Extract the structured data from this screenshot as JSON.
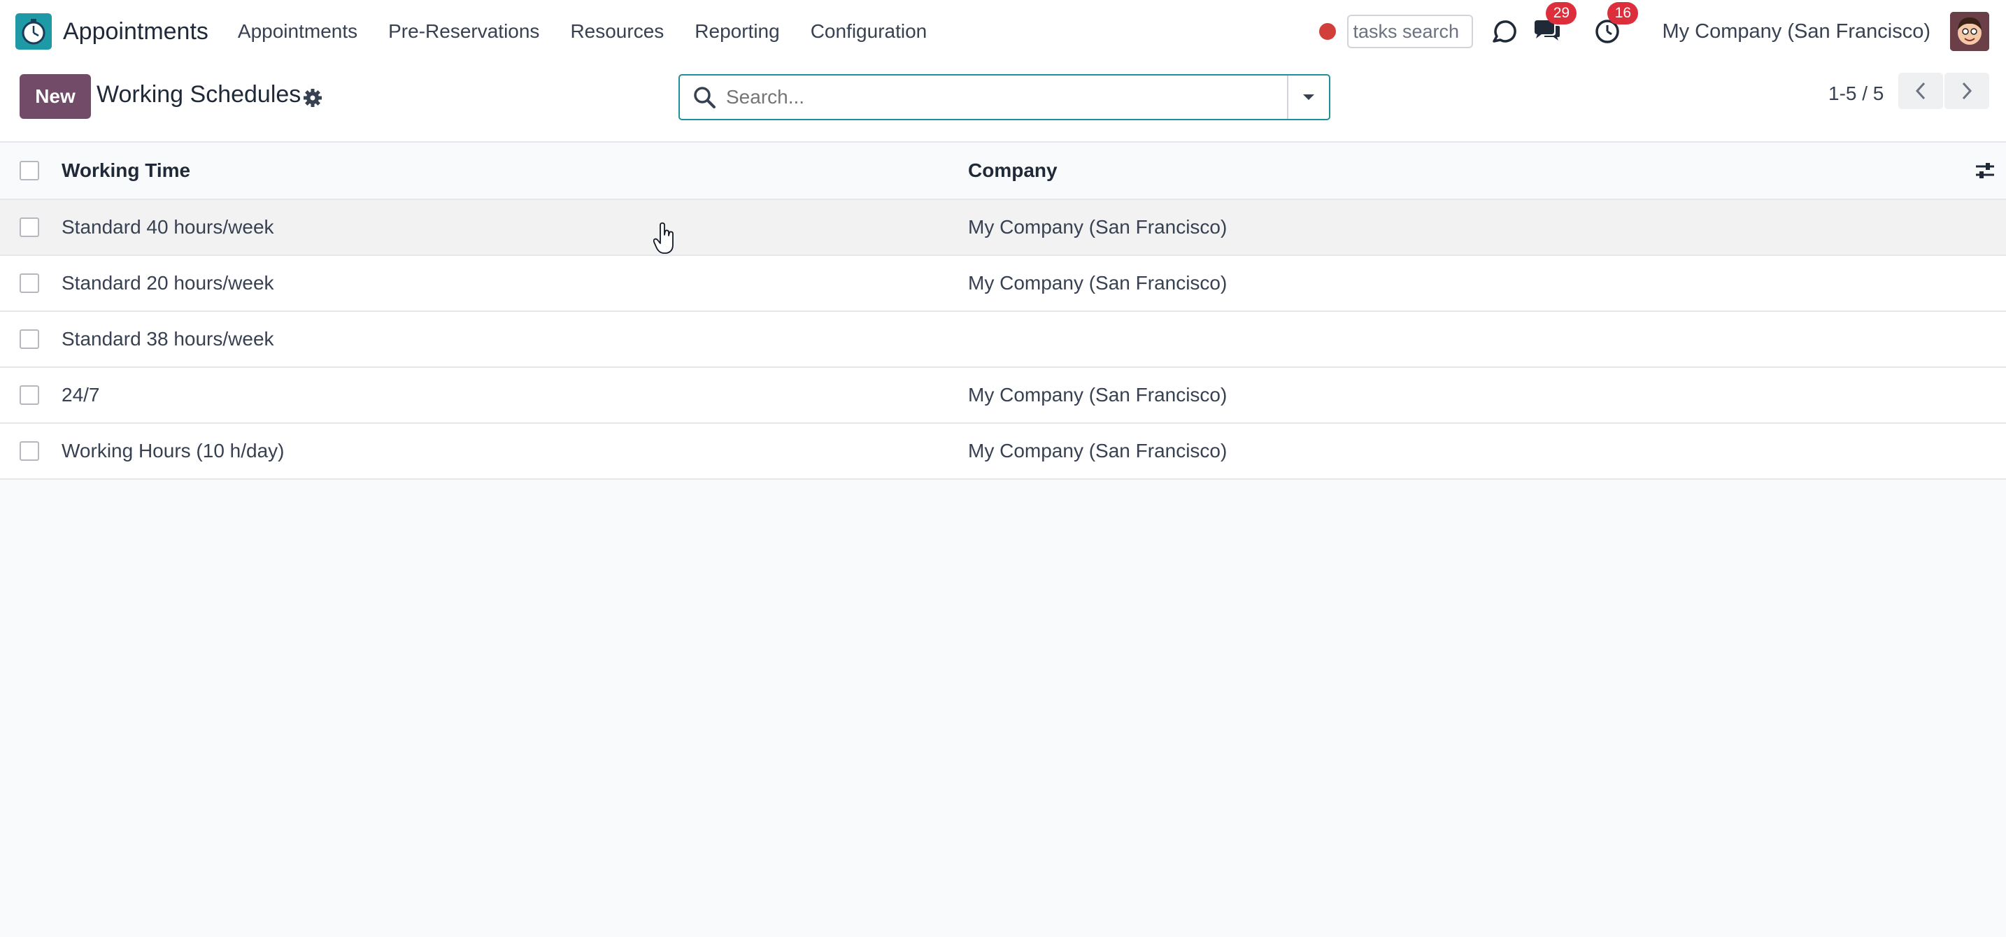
{
  "navbar": {
    "app_name": "Appointments",
    "menu": [
      "Appointments",
      "Pre-Reservations",
      "Resources",
      "Reporting",
      "Configuration"
    ],
    "tasks_search_value": "tasks search",
    "messages_count": "29",
    "activities_count": "16",
    "company": "My Company (San Francisco)"
  },
  "control_panel": {
    "new_label": "New",
    "title": "Working Schedules",
    "search_placeholder": "Search...",
    "pager": "1-5 / 5"
  },
  "table": {
    "columns": [
      "Working Time",
      "Company"
    ],
    "rows": [
      {
        "name": "Standard 40 hours/week",
        "company": "My Company (San Francisco)"
      },
      {
        "name": "Standard 20 hours/week",
        "company": "My Company (San Francisco)"
      },
      {
        "name": "Standard 38 hours/week",
        "company": ""
      },
      {
        "name": "24/7",
        "company": "My Company (San Francisco)"
      },
      {
        "name": "Working Hours (10 h/day)",
        "company": "My Company (San Francisco)"
      }
    ]
  },
  "colors": {
    "brand": "#714b67",
    "accent": "#1f8f99",
    "badge": "#dc2f3b",
    "record": "#d23f3a"
  },
  "icons": [
    "app-logo-icon",
    "odoobot-icon",
    "chat-icon",
    "activity-clock-icon",
    "gear-icon",
    "search-icon",
    "caret-down-icon",
    "chevron-left-icon",
    "chevron-right-icon",
    "optional-columns-icon"
  ]
}
